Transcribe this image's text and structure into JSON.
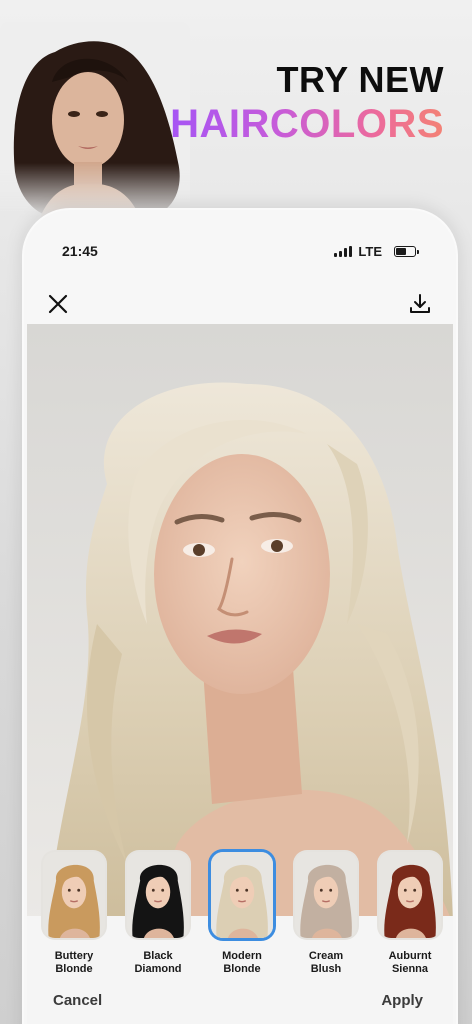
{
  "headline": {
    "line1": "TRY NEW",
    "line2": "HAIRCOLORS"
  },
  "status": {
    "time": "21:45",
    "network": "LTE"
  },
  "icons": {
    "close": "close-icon",
    "download": "download-icon",
    "signal": "signal-icon",
    "battery": "battery-icon"
  },
  "swatches": [
    {
      "label": "Buttery Blonde",
      "selected": false,
      "hair_color": "#c99a5e"
    },
    {
      "label": "Black Diamond",
      "selected": false,
      "hair_color": "#141414"
    },
    {
      "label": "Modern Blonde",
      "selected": true,
      "hair_color": "#dccfb4"
    },
    {
      "label": "Cream Blush",
      "selected": false,
      "hair_color": "#c2b0a1"
    },
    {
      "label": "Auburnt Sienna",
      "selected": false,
      "hair_color": "#7a2a1a"
    }
  ],
  "actions": {
    "cancel": "Cancel",
    "apply": "Apply"
  },
  "colors": {
    "selected_border": "#3d8de0",
    "headline_gradient": [
      "#a655f4",
      "#ec6a9c",
      "#f38275"
    ]
  }
}
